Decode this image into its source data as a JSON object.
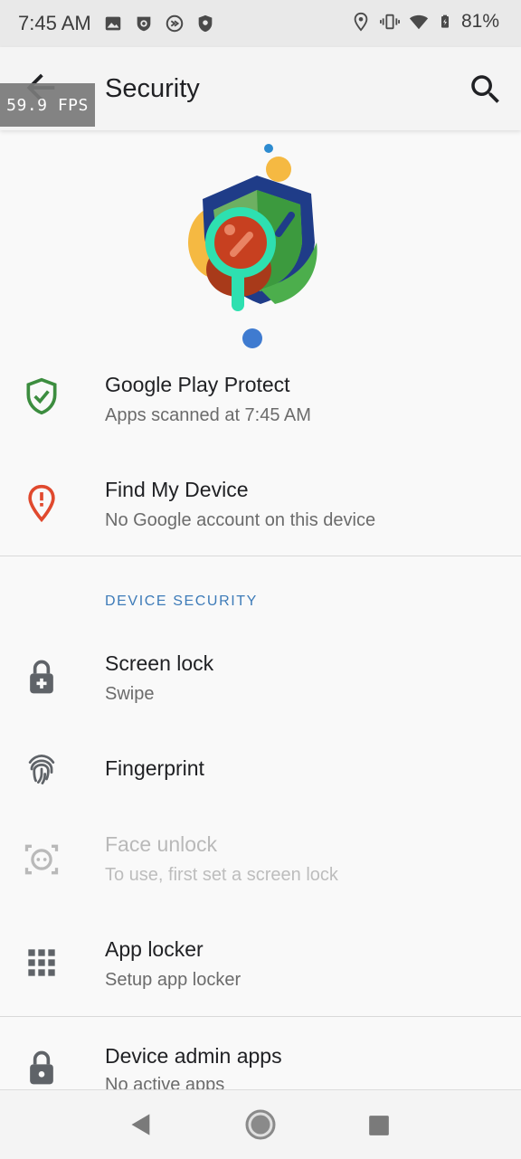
{
  "status_bar": {
    "time": "7:45 AM",
    "battery": "81%",
    "icons_left": [
      "image-icon",
      "shield-face-icon",
      "link-icon",
      "shield-icon"
    ],
    "icons_right": [
      "location-icon",
      "vibrate-icon",
      "wifi-icon",
      "battery-icon"
    ]
  },
  "app_bar": {
    "title": "Security",
    "fps": "59.9 FPS"
  },
  "items": [
    {
      "title": "Google Play Protect",
      "subtitle": "Apps scanned at 7:45 AM",
      "icon": "shield-check-icon",
      "icon_color": "#3c8d3f"
    },
    {
      "title": "Find My Device",
      "subtitle": "No Google account on this device",
      "icon": "location-alert-icon",
      "icon_color": "#e0492e"
    }
  ],
  "device_security": {
    "header": "DEVICE SECURITY",
    "items": [
      {
        "title": "Screen lock",
        "subtitle": "Swipe",
        "icon": "lock-plus-icon"
      },
      {
        "title": "Fingerprint",
        "icon": "fingerprint-icon"
      },
      {
        "title": "Face unlock",
        "subtitle": "To use, first set a screen lock",
        "icon": "face-icon",
        "enabled": false
      },
      {
        "title": "App locker",
        "subtitle": "Setup app locker",
        "icon": "apps-grid-icon"
      },
      {
        "title": "Device admin apps",
        "subtitle": "No active apps",
        "icon": "lock-icon"
      }
    ]
  },
  "colors": {
    "accent": "#3d7bb8",
    "icon_gray": "#5f6368"
  }
}
